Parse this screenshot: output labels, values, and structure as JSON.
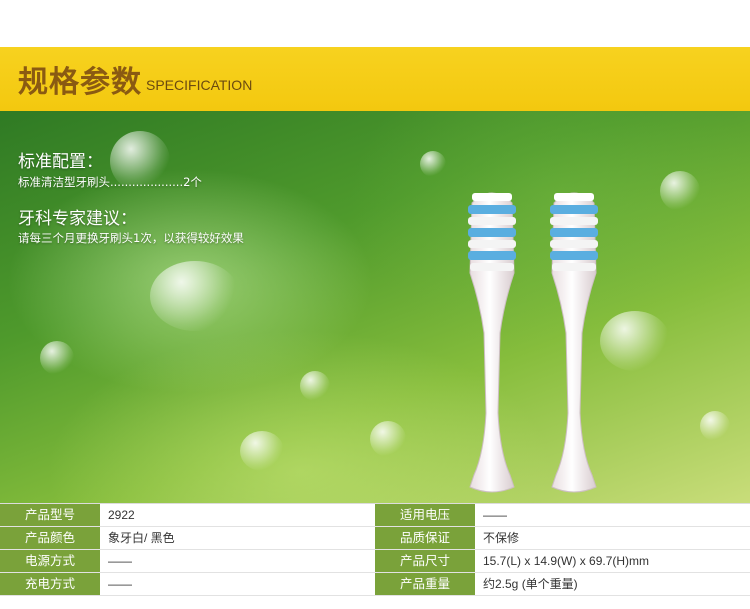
{
  "header": {
    "title": "规格参数",
    "subtitle": "SPECIFICATION"
  },
  "standard": {
    "heading": "标准配置：",
    "item": "标准清洁型牙刷头....................2个"
  },
  "advice": {
    "heading": "牙科专家建议：",
    "text": "请每三个月更换牙刷头1次，以获得较好效果"
  },
  "colors": {
    "header_band": "#f3c80f",
    "label_bg": "#7aa23a"
  },
  "specs": {
    "left": [
      {
        "label": "产品型号",
        "value": "2922"
      },
      {
        "label": "产品颜色",
        "value": "象牙白/ 黑色"
      },
      {
        "label": "电源方式",
        "value": "——"
      },
      {
        "label": "充电方式",
        "value": "——"
      }
    ],
    "right": [
      {
        "label": "适用电压",
        "value": "——"
      },
      {
        "label": "品质保证",
        "value": "不保修"
      },
      {
        "label": "产品尺寸",
        "value": "15.7(L) x 14.9(W) x 69.7(H)mm"
      },
      {
        "label": "产品重量",
        "value": "约2.5g (单个重量)"
      }
    ]
  }
}
